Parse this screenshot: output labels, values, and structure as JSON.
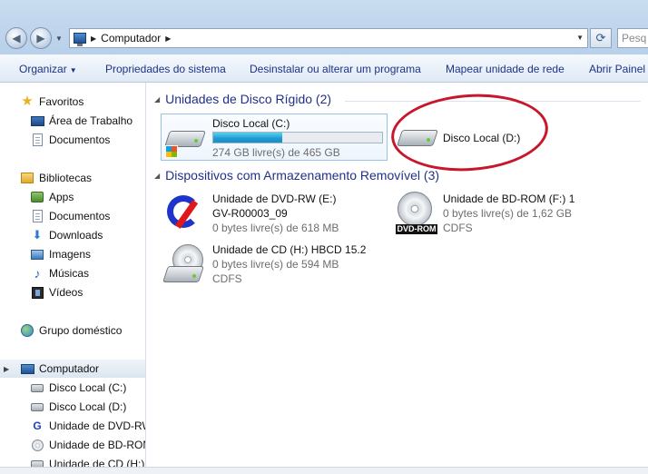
{
  "address": {
    "crumb": "Computador",
    "search_placeholder": "Pesq"
  },
  "toolbar": {
    "organize": "Organizar",
    "system_props": "Propriedades do sistema",
    "uninstall": "Desinstalar ou alterar um programa",
    "map_drive": "Mapear unidade de rede",
    "open_panel": "Abrir Painel"
  },
  "sidebar": {
    "favorites": {
      "title": "Favoritos",
      "items": [
        "Área de Trabalho",
        "Documentos"
      ]
    },
    "libraries": {
      "title": "Bibliotecas",
      "items": [
        "Apps",
        "Documentos",
        "Downloads",
        "Imagens",
        "Músicas",
        "Vídeos"
      ]
    },
    "homegroup": "Grupo doméstico",
    "computer": {
      "title": "Computador",
      "items": [
        "Disco Local (C:)",
        "Disco Local (D:)",
        "Unidade de DVD-RW",
        "Unidade de BD-ROM",
        "Unidade de CD (H:)"
      ]
    }
  },
  "groups": {
    "hdd": {
      "title": "Unidades de Disco Rígido (2)",
      "drives": [
        {
          "name": "Disco Local (C:)",
          "free": "274 GB livre(s) de 465 GB",
          "used_fraction": 0.41
        },
        {
          "name": "Disco Local (D:)"
        }
      ]
    },
    "removable": {
      "title": "Dispositivos com Armazenamento Removível (3)",
      "drives": [
        {
          "name": "Unidade de DVD-RW (E:)",
          "label": "GV-R00003_09",
          "free": "0 bytes livre(s) de 618 MB"
        },
        {
          "name": "Unidade de BD-ROM (F:) 1",
          "free": "0 bytes livre(s) de 1,62 GB",
          "fs": "CDFS",
          "badge": "DVD-ROM"
        },
        {
          "name": "Unidade de CD (H:) HBCD 15.2",
          "free": "0 bytes livre(s) de 594 MB",
          "fs": "CDFS"
        }
      ]
    }
  },
  "annotation_color": "#c8162b",
  "accent_color": "#1e3287"
}
